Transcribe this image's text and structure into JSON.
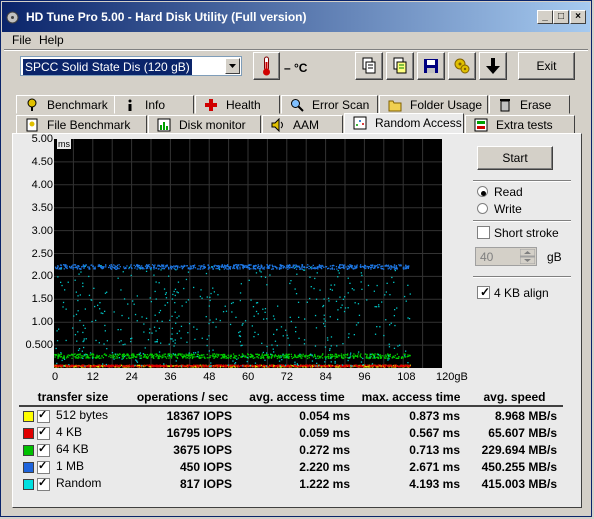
{
  "window": {
    "title": "HD Tune Pro 5.00 - Hard Disk Utility (Full version)"
  },
  "menu": [
    {
      "label": "File"
    },
    {
      "label": "Help"
    }
  ],
  "toolbar": {
    "drive": "SPCC Solid State Dis (120 gB)",
    "temperature": "– °C",
    "exit_label": "Exit",
    "icons": [
      "copy-icon",
      "copy-all-icon",
      "save-icon",
      "options-icon",
      "download-icon"
    ]
  },
  "tabs_row1": [
    {
      "label": "Benchmark",
      "icon": "benchmark-icon"
    },
    {
      "label": "Info",
      "icon": "info-icon"
    },
    {
      "label": "Health",
      "icon": "health-icon"
    },
    {
      "label": "Error Scan",
      "icon": "error-scan-icon"
    },
    {
      "label": "Folder Usage",
      "icon": "folder-icon"
    },
    {
      "label": "Erase",
      "icon": "erase-icon"
    }
  ],
  "tabs_row2": [
    {
      "label": "File Benchmark",
      "icon": "file-benchmark-icon"
    },
    {
      "label": "Disk monitor",
      "icon": "disk-monitor-icon"
    },
    {
      "label": "AAM",
      "icon": "aam-icon"
    },
    {
      "label": "Random Access",
      "icon": "random-access-icon",
      "active": true
    },
    {
      "label": "Extra tests",
      "icon": "extra-tests-icon"
    }
  ],
  "controls": {
    "start_label": "Start",
    "read_label": "Read",
    "write_label": "Write",
    "mode_selected": "Read",
    "short_stroke_label": "Short stroke",
    "short_stroke_checked": false,
    "short_stroke_value": "40",
    "short_stroke_unit": "gB",
    "align_label": "4 KB align",
    "align_checked": true
  },
  "chart_data": {
    "type": "scatter",
    "ylabel": "ms",
    "y_ticks": [
      "5.00",
      "4.50",
      "4.00",
      "3.50",
      "3.00",
      "2.50",
      "2.00",
      "1.50",
      "1.00",
      "0.500"
    ],
    "x_ticks": [
      "0",
      "12",
      "24",
      "36",
      "48",
      "60",
      "72",
      "84",
      "96",
      "108",
      "120gB"
    ],
    "xlim": [
      0,
      120
    ],
    "ylim": [
      0,
      5.0
    ],
    "grid": true,
    "series": [
      {
        "name": "512 bytes",
        "color": "#e0e000",
        "y_center": 0.054,
        "spread": 0.02
      },
      {
        "name": "4 KB",
        "color": "#e00000",
        "y_center": 0.059,
        "spread": 0.02
      },
      {
        "name": "64 KB",
        "color": "#00d000",
        "y_center": 0.272,
        "spread": 0.05
      },
      {
        "name": "1 MB",
        "color": "#1e78e6",
        "y_center": 2.22,
        "spread": 0.05
      },
      {
        "name": "Random",
        "color": "#00c8c8",
        "y_center": 1.222,
        "spread": 1.0
      }
    ]
  },
  "results": {
    "headers": [
      "transfer size",
      "operations / sec",
      "avg. access time",
      "max. access time",
      "avg. speed"
    ],
    "rows": [
      {
        "label": "512 bytes",
        "color": "#ffff00",
        "ops": "18367 IOPS",
        "avg": "0.054 ms",
        "max": "0.873 ms",
        "speed": "8.968 MB/s"
      },
      {
        "label": "4 KB",
        "color": "#e00000",
        "ops": "16795 IOPS",
        "avg": "0.059 ms",
        "max": "0.567 ms",
        "speed": "65.607 MB/s"
      },
      {
        "label": "64 KB",
        "color": "#00c000",
        "ops": "3675 IOPS",
        "avg": "0.272 ms",
        "max": "0.713 ms",
        "speed": "229.694 MB/s"
      },
      {
        "label": "1 MB",
        "color": "#1e64dc",
        "ops": "450 IOPS",
        "avg": "2.220 ms",
        "max": "2.671 ms",
        "speed": "450.255 MB/s"
      },
      {
        "label": "Random",
        "color": "#00e0e0",
        "ops": "817 IOPS",
        "avg": "1.222 ms",
        "max": "4.193 ms",
        "speed": "415.003 MB/s"
      }
    ]
  }
}
